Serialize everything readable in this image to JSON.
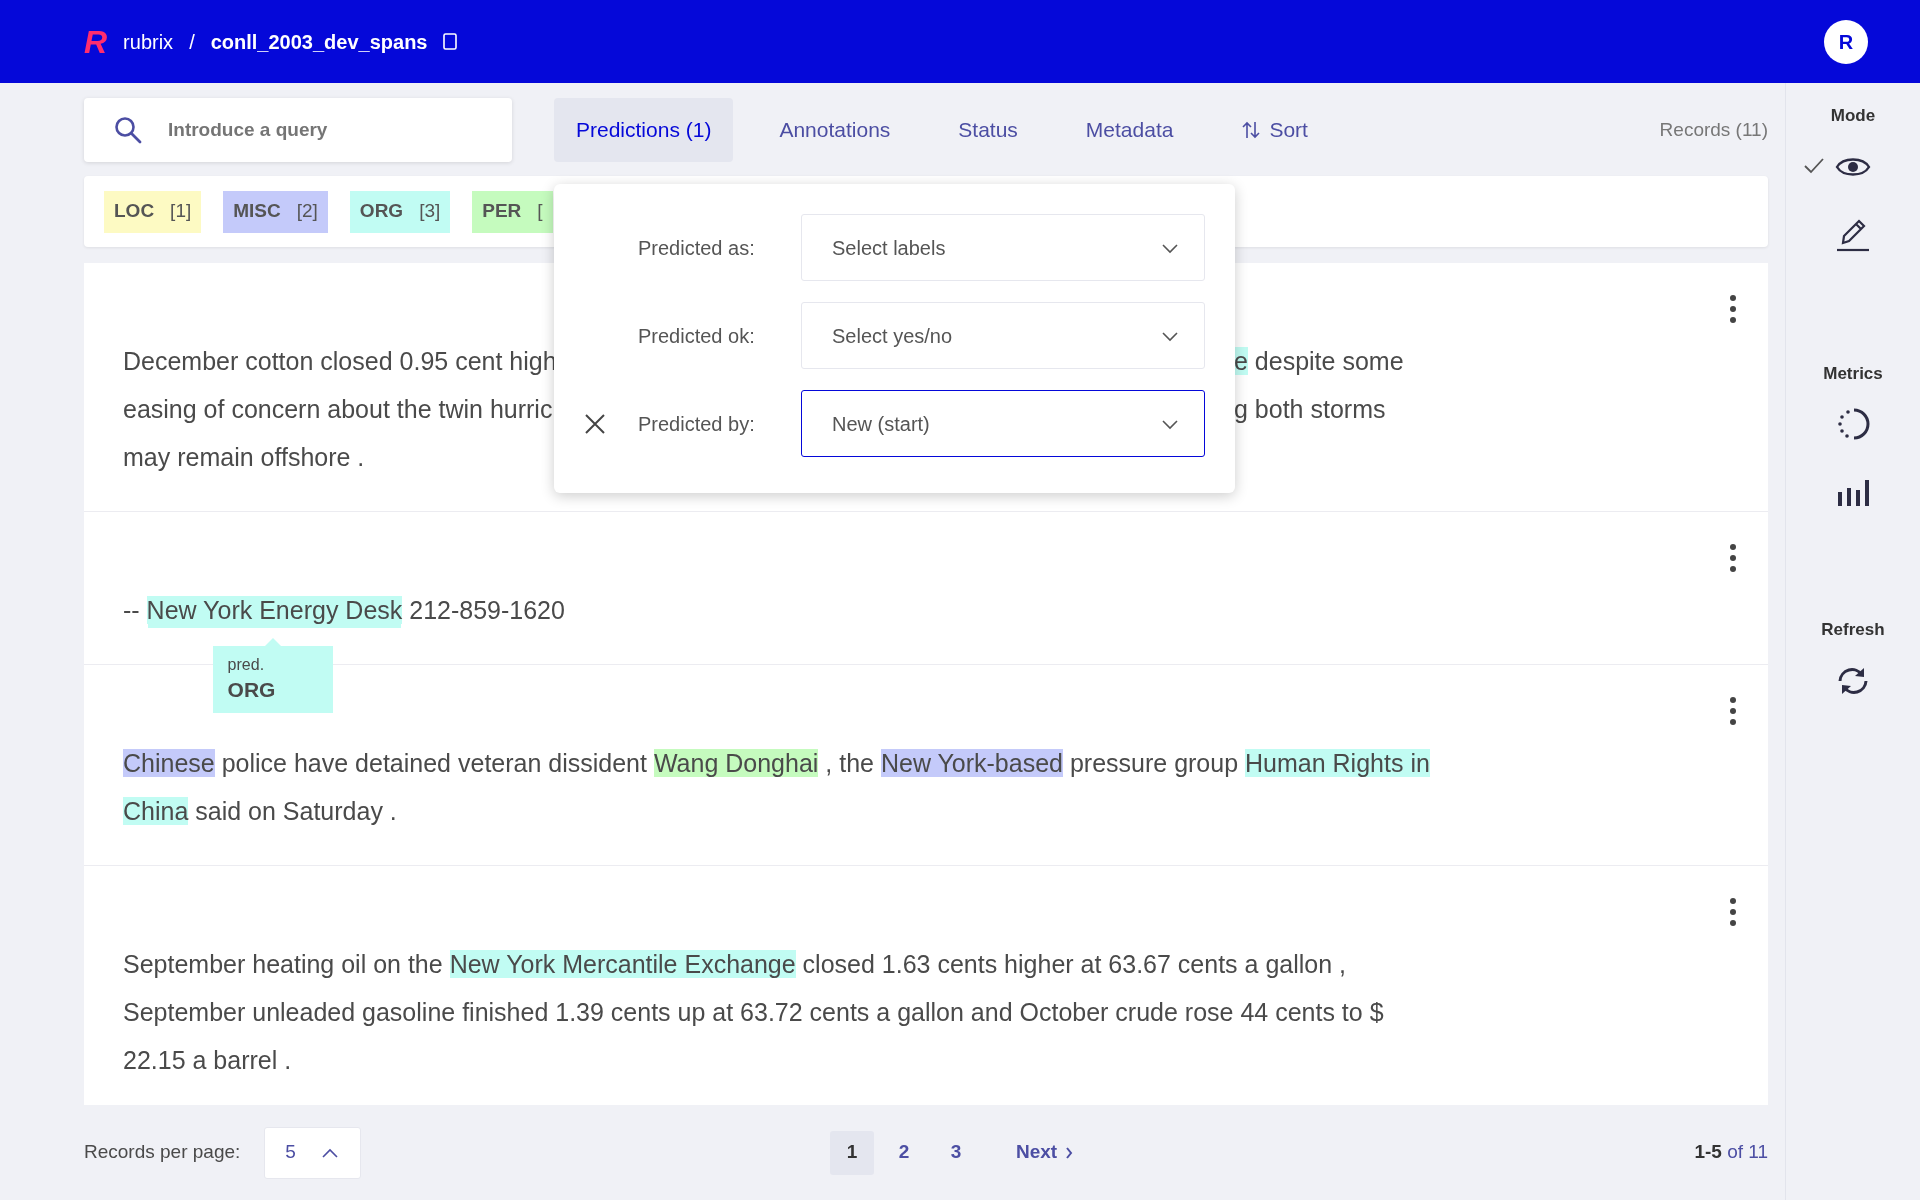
{
  "header": {
    "logo": "R",
    "breadcrumbs": [
      "rubrix",
      "/",
      "conll_2003_dev_spans"
    ],
    "avatar": "R"
  },
  "search": {
    "placeholder": "Introduce a query"
  },
  "filters": [
    {
      "label": "Predictions (1)",
      "selected": true
    },
    {
      "label": "Annotations",
      "selected": false
    },
    {
      "label": "Status",
      "selected": false
    },
    {
      "label": "Metadata",
      "selected": false
    },
    {
      "label": "Sort",
      "selected": false,
      "kind": "sort"
    }
  ],
  "records_count": "Records (11)",
  "labels": [
    {
      "name": "LOC",
      "count": "[1]",
      "color": "#fdfac3"
    },
    {
      "name": "MISC",
      "count": "[2]",
      "color": "#c4cafa"
    },
    {
      "name": "ORG",
      "count": "[3]",
      "color": "#c1fcf3"
    },
    {
      "name": "PER",
      "count": "[",
      "color": "#c5fbbe"
    }
  ],
  "popup": {
    "rows": [
      {
        "label": "Predicted as:",
        "value": "Select labels",
        "focused": false,
        "removable": false
      },
      {
        "label": "Predicted ok:",
        "value": "Select yes/no",
        "focused": false,
        "removable": false
      },
      {
        "label": "Predicted by:",
        "value": "New (start)",
        "focused": true,
        "removable": true
      }
    ]
  },
  "records": [
    {
      "lines": [
        {
          "parts": [
            [
              {
                "text": "December cotton closed 0.95 cent high"
              }
            ],
            [
              {
                "text": "e",
                "color": "#c1fcf3"
              },
              {
                "text": " despite some"
              }
            ]
          ]
        },
        {
          "parts": [
            [
              {
                "text": "easing of concern about the twin hurric"
              }
            ],
            [
              {
                "text": "g both storms"
              }
            ]
          ]
        },
        {
          "parts": [
            [
              {
                "text": "may remain offshore ."
              }
            ]
          ]
        }
      ]
    },
    {
      "lines": [
        {
          "parts": [
            [
              {
                "text": "-- "
              },
              {
                "text": "New York Energy Desk",
                "color": "#c1fcf3",
                "hovered": true,
                "tooltip": {
                  "caption": "pred.",
                  "label": "ORG"
                }
              },
              {
                "text": " 212-859-1620"
              }
            ]
          ]
        }
      ]
    },
    {
      "lines": [
        {
          "parts": [
            [
              {
                "text": "Chinese",
                "color": "#c4cafa"
              },
              {
                "text": " police have detained veteran dissident "
              },
              {
                "text": "Wang Donghai",
                "color": "#c5fbbe"
              },
              {
                "text": " , the "
              },
              {
                "text": "New York-based",
                "color": "#c4cafa"
              },
              {
                "text": " pressure group "
              },
              {
                "text": "Human Rights in",
                "color": "#c1fcf3"
              }
            ]
          ]
        },
        {
          "parts": [
            [
              {
                "text": "China",
                "color": "#c1fcf3"
              },
              {
                "text": " said on Saturday ."
              }
            ]
          ]
        }
      ]
    },
    {
      "lines": [
        {
          "parts": [
            [
              {
                "text": "September heating oil on the "
              },
              {
                "text": "New York Mercantile Exchange",
                "color": "#c1fcf3"
              },
              {
                "text": " closed 1.63 cents higher at 63.67 cents a gallon ,"
              }
            ]
          ]
        },
        {
          "parts": [
            [
              {
                "text": "September unleaded gasoline finished 1.39 cents up at 63.72 cents a gallon and October crude rose 44 cents to $"
              }
            ]
          ]
        },
        {
          "parts": [
            [
              {
                "text": "22.15 a barrel ."
              }
            ]
          ]
        }
      ]
    }
  ],
  "sidebar": {
    "sections": [
      {
        "title": "Mode",
        "items": [
          {
            "kind": "view",
            "selected": true
          },
          {
            "kind": "edit",
            "selected": false
          }
        ]
      },
      {
        "title": "Metrics",
        "items": [
          {
            "kind": "progress",
            "selected": false
          },
          {
            "kind": "stats",
            "selected": false
          }
        ]
      },
      {
        "title": "Refresh",
        "items": [
          {
            "kind": "refresh",
            "selected": false
          }
        ]
      }
    ]
  },
  "footer": {
    "per_page_label": "Records per page:",
    "per_page": "5",
    "pages": [
      {
        "label": "1",
        "selected": true
      },
      {
        "label": "2",
        "selected": false
      },
      {
        "label": "3",
        "selected": false
      }
    ],
    "next": "Next",
    "range": "**1-5** of 11"
  }
}
